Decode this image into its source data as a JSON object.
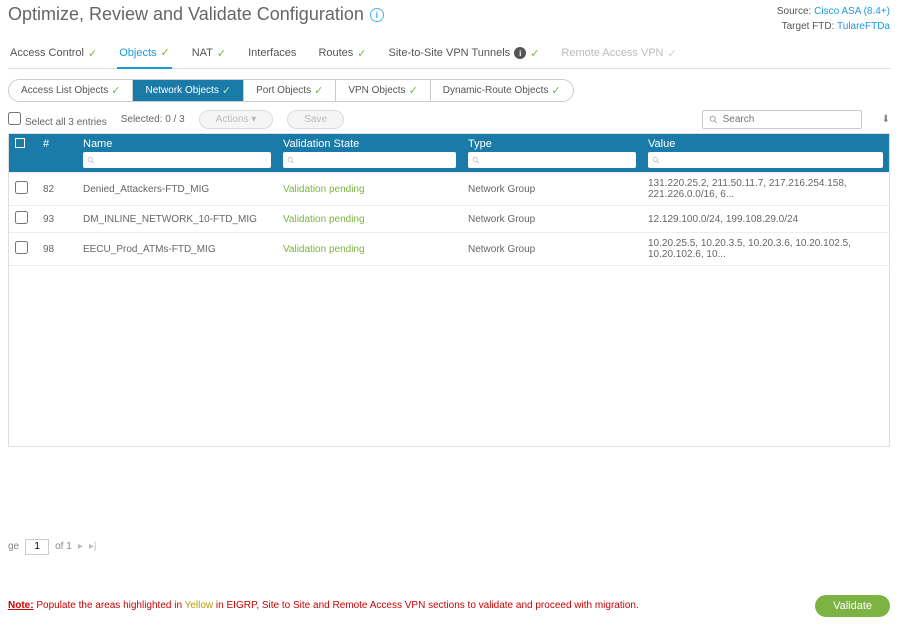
{
  "header": {
    "title": "Optimize, Review and Validate Configuration",
    "source_label": "Source:",
    "source_value": "Cisco ASA (8.4+)",
    "target_label": "Target FTD:",
    "target_value": "TulareFTDa"
  },
  "tabs": [
    {
      "label": "Access Control",
      "active": false,
      "disabled": false
    },
    {
      "label": "Objects",
      "active": true,
      "disabled": false
    },
    {
      "label": "NAT",
      "active": false,
      "disabled": false
    },
    {
      "label": "Interfaces",
      "active": false,
      "disabled": false
    },
    {
      "label": "Routes",
      "active": false,
      "disabled": false
    },
    {
      "label": "Site-to-Site VPN Tunnels",
      "active": false,
      "info": true,
      "disabled": false
    },
    {
      "label": "Remote Access VPN",
      "active": false,
      "disabled": true
    }
  ],
  "subtabs": [
    {
      "label": "Access List Objects",
      "active": false
    },
    {
      "label": "Network Objects",
      "active": true
    },
    {
      "label": "Port Objects",
      "active": false
    },
    {
      "label": "VPN Objects",
      "active": false
    },
    {
      "label": "Dynamic-Route Objects",
      "active": false
    }
  ],
  "selection": {
    "select_all": "Select all 3 entries",
    "selected": "Selected: 0 / 3",
    "actions_btn": "Actions",
    "save_btn": "Save"
  },
  "search": {
    "placeholder": "Search"
  },
  "columns": {
    "num": "#",
    "name": "Name",
    "validation": "Validation State",
    "type": "Type",
    "value": "Value"
  },
  "rows": [
    {
      "num": "82",
      "name": "Denied_Attackers-FTD_MIG",
      "validation": "Validation pending",
      "type": "Network Group",
      "value": "131.220.25.2, 211.50.11.7, 217.216.254.158, 221.226.0.0/16, 6..."
    },
    {
      "num": "93",
      "name": "DM_INLINE_NETWORK_10-FTD_MIG",
      "validation": "Validation pending",
      "type": "Network Group",
      "value": "12.129.100.0/24, 199.108.29.0/24"
    },
    {
      "num": "98",
      "name": "EECU_Prod_ATMs-FTD_MIG",
      "validation": "Validation pending",
      "type": "Network Group",
      "value": "10.20.25.5, 10.20.3.5, 10.20.3.6, 10.20.102.5, 10.20.102.6, 10..."
    }
  ],
  "pager": {
    "page_label": "ge",
    "page": "1",
    "of": "of 1",
    "next": "▸",
    "last": "▸|"
  },
  "footer": {
    "note_label": "Note:",
    "note_prefix": "Populate the areas highlighted in ",
    "note_yellow": "Yellow",
    "note_suffix": " in EIGRP, Site to Site and Remote Access VPN sections to validate and proceed with migration.",
    "validate": "Validate"
  }
}
